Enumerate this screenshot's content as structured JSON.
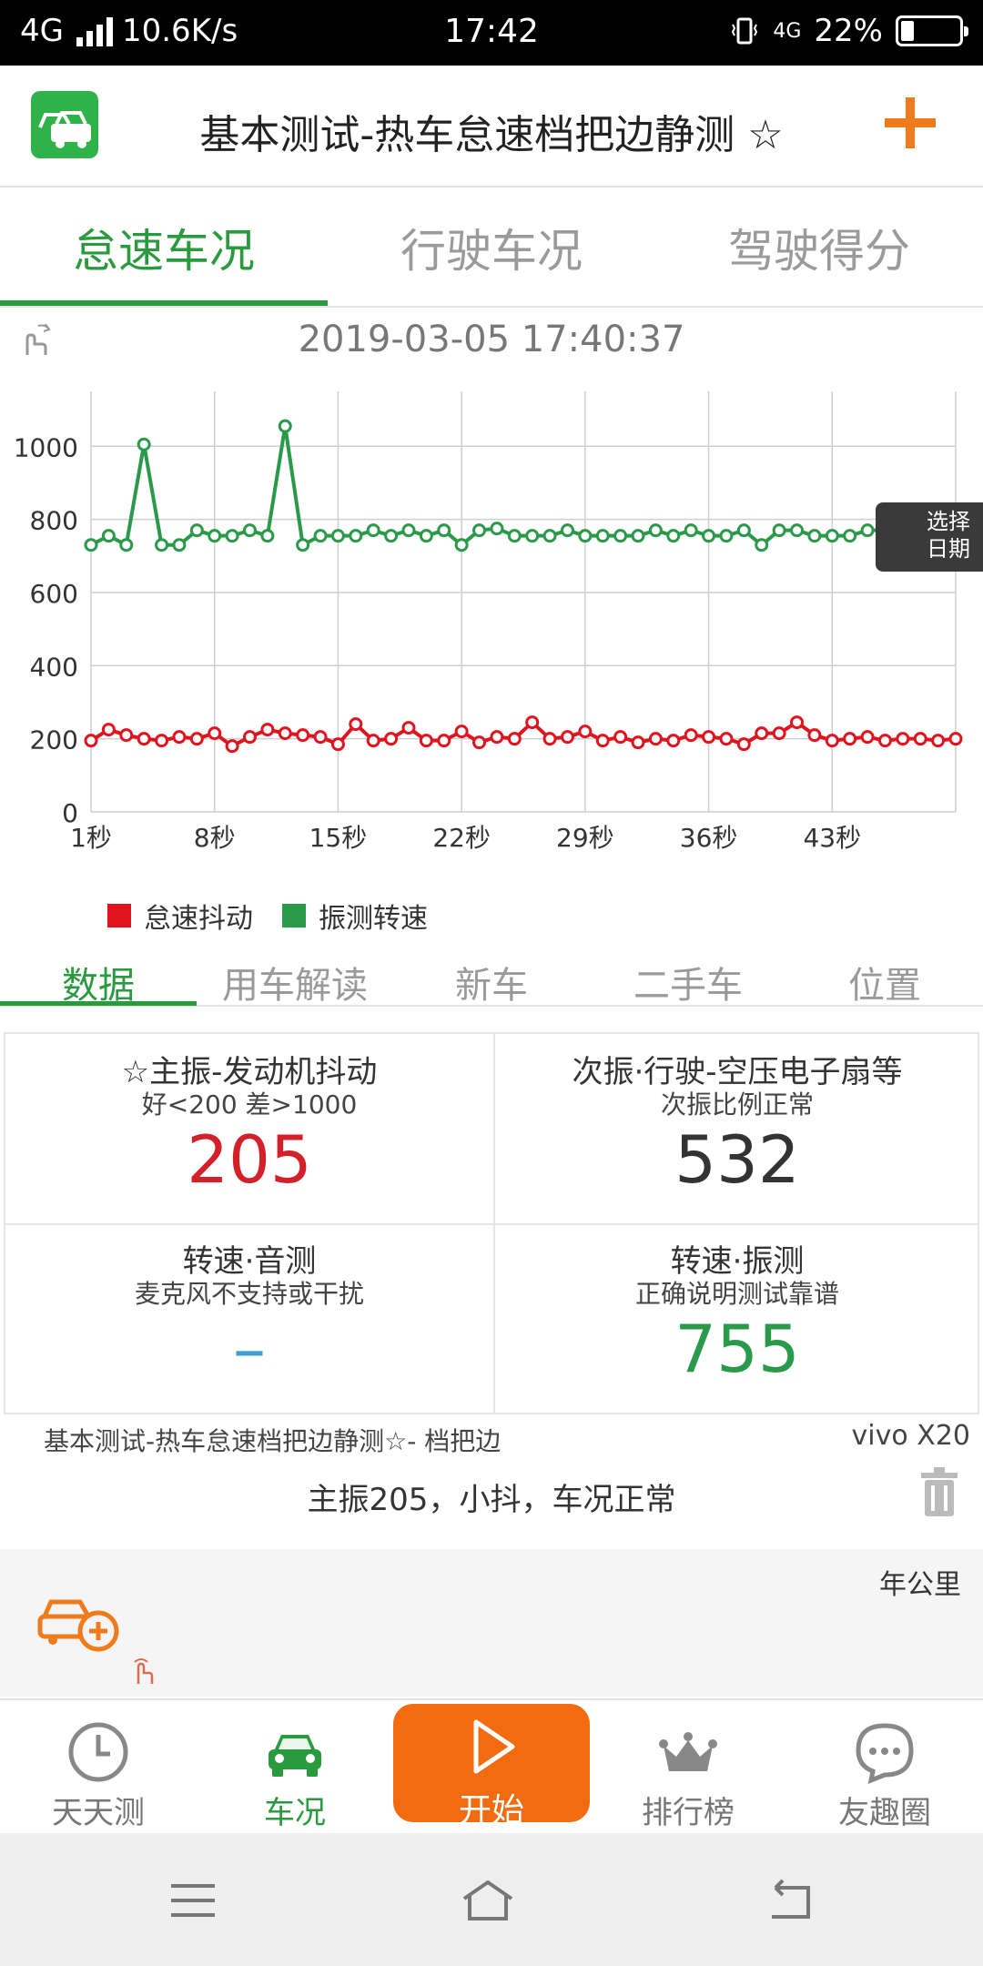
{
  "status_bar": {
    "network": "4G",
    "speed": "10.6K/s",
    "time": "17:42",
    "network2": "4G",
    "battery": "22%",
    "battery_level": 0.22
  },
  "header": {
    "title": "基本测试-热车怠速档把边静测 ☆",
    "accent": "#f07b1c",
    "app_icon": "car-icon",
    "add_icon": "plus-icon"
  },
  "top_tabs": [
    {
      "label": "怠速车况",
      "active": true
    },
    {
      "label": "行驶车况",
      "active": false
    },
    {
      "label": "驾驶得分",
      "active": false
    }
  ],
  "date": "2019-03-05 17:40:37",
  "select_date": {
    "line1": "选择",
    "line2": "日期"
  },
  "chart_data": {
    "type": "line",
    "x": [
      1,
      2,
      3,
      4,
      5,
      6,
      7,
      8,
      9,
      10,
      11,
      12,
      13,
      14,
      15,
      16,
      17,
      18,
      19,
      20,
      21,
      22,
      23,
      24,
      25,
      26,
      27,
      28,
      29,
      30,
      31,
      32,
      33,
      34,
      35,
      36,
      37,
      38,
      39,
      40,
      41,
      42,
      43,
      44,
      45,
      46,
      47,
      48,
      49,
      50
    ],
    "xticks": [
      "1秒",
      "8秒",
      "15秒",
      "22秒",
      "29秒",
      "36秒",
      "43秒"
    ],
    "xtick_values": [
      1,
      8,
      15,
      22,
      29,
      36,
      43
    ],
    "ylim": [
      0,
      1150
    ],
    "yticks": [
      0,
      200,
      400,
      600,
      800,
      1000
    ],
    "grid": true,
    "legend": "bottom-left",
    "series": [
      {
        "name": "怠速抖动",
        "color": "#e0141e",
        "values": [
          195,
          225,
          210,
          200,
          195,
          205,
          200,
          215,
          180,
          205,
          225,
          215,
          210,
          205,
          185,
          240,
          195,
          200,
          230,
          195,
          195,
          220,
          190,
          205,
          200,
          245,
          200,
          205,
          220,
          195,
          205,
          190,
          200,
          195,
          210,
          205,
          200,
          185,
          215,
          215,
          245,
          210,
          195,
          200,
          205,
          195,
          200,
          200,
          195,
          200
        ]
      },
      {
        "name": "振测转速",
        "color": "#2a9a4a",
        "values": [
          730,
          755,
          730,
          1005,
          730,
          730,
          770,
          755,
          755,
          770,
          755,
          1055,
          730,
          755,
          755,
          755,
          770,
          755,
          770,
          755,
          770,
          730,
          770,
          775,
          755,
          755,
          755,
          770,
          755,
          755,
          755,
          755,
          770,
          755,
          770,
          755,
          755,
          770,
          730,
          770,
          770,
          755,
          755,
          755,
          770,
          770,
          755,
          755,
          755,
          755
        ]
      }
    ]
  },
  "sub_tabs": [
    {
      "label": "数据",
      "active": true
    },
    {
      "label": "用车解读",
      "active": false
    },
    {
      "label": "新车",
      "active": false
    },
    {
      "label": "二手车",
      "active": false
    },
    {
      "label": "位置",
      "active": false
    }
  ],
  "cells": [
    {
      "title": "☆主振-发动机抖动",
      "sub": "好<200  差>1000",
      "value": "205",
      "color": "#d4202a"
    },
    {
      "title": "次振·行驶-空压电子扇等",
      "sub": "次振比例正常",
      "value": "532",
      "color": "#333333"
    },
    {
      "title": "转速·音测",
      "sub": "麦克风不支持或干扰",
      "value": "–",
      "color": "#3aa0d0"
    },
    {
      "title": "转速·振测",
      "sub": "正确说明测试靠谱",
      "value": "755",
      "color": "#2a9a4a"
    }
  ],
  "result": {
    "line": "基本测试-热车怠速档把边静测☆- 档把边",
    "device": "vivo X20",
    "text": "主振205，小抖，车况正常"
  },
  "km_label": "年公里",
  "bottom_nav": [
    {
      "label": "天天测",
      "icon": "clock-icon",
      "active": false
    },
    {
      "label": "车况",
      "icon": "car-icon",
      "active": true
    },
    {
      "label": "开始",
      "icon": "play-icon",
      "active": false
    },
    {
      "label": "排行榜",
      "icon": "crown-icon",
      "active": false
    },
    {
      "label": "友趣圈",
      "icon": "chat-icon",
      "active": false
    }
  ]
}
